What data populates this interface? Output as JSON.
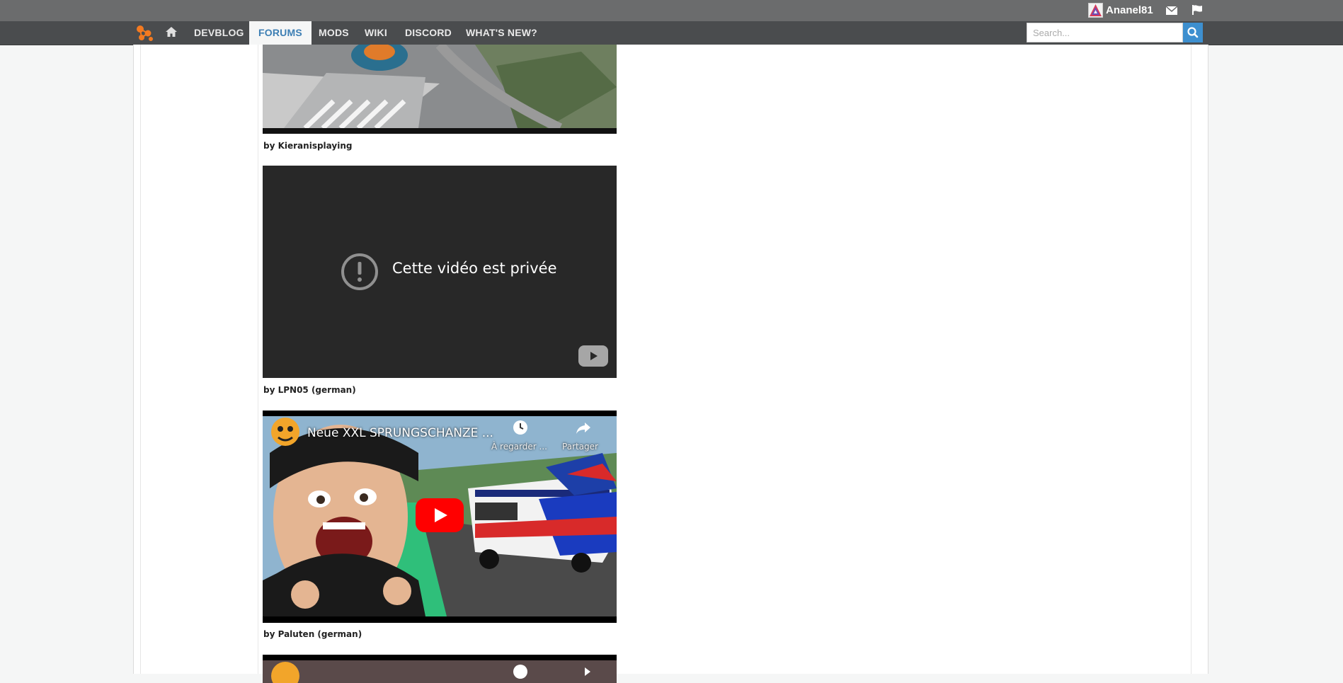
{
  "userbar": {
    "username": "Ananel81",
    "icons": [
      "envelope-icon",
      "flag-icon"
    ]
  },
  "nav": {
    "items": [
      {
        "label": "DEVBLOG"
      },
      {
        "label": "FORUMS",
        "active": true
      },
      {
        "label": "MODS"
      },
      {
        "label": "WIKI"
      },
      {
        "label": "DISCORD"
      },
      {
        "label": "WHAT'S NEW?"
      }
    ],
    "search_placeholder": "Search..."
  },
  "videos": [
    {
      "caption": "by Kieranisplaying"
    },
    {
      "message": "Cette vidéo est privée",
      "caption": "by LPN05 (german)"
    },
    {
      "title": "Neue XXL SPRUNGSCHANZE ...",
      "watch_later": "À regarder ...",
      "share": "Partager",
      "caption": "by Paluten (german)"
    }
  ],
  "colors": {
    "userbar": "#6b6c6d",
    "navbar": "#4a4c4e",
    "accent": "#3d8fcf",
    "yt_red": "#ff0000"
  }
}
